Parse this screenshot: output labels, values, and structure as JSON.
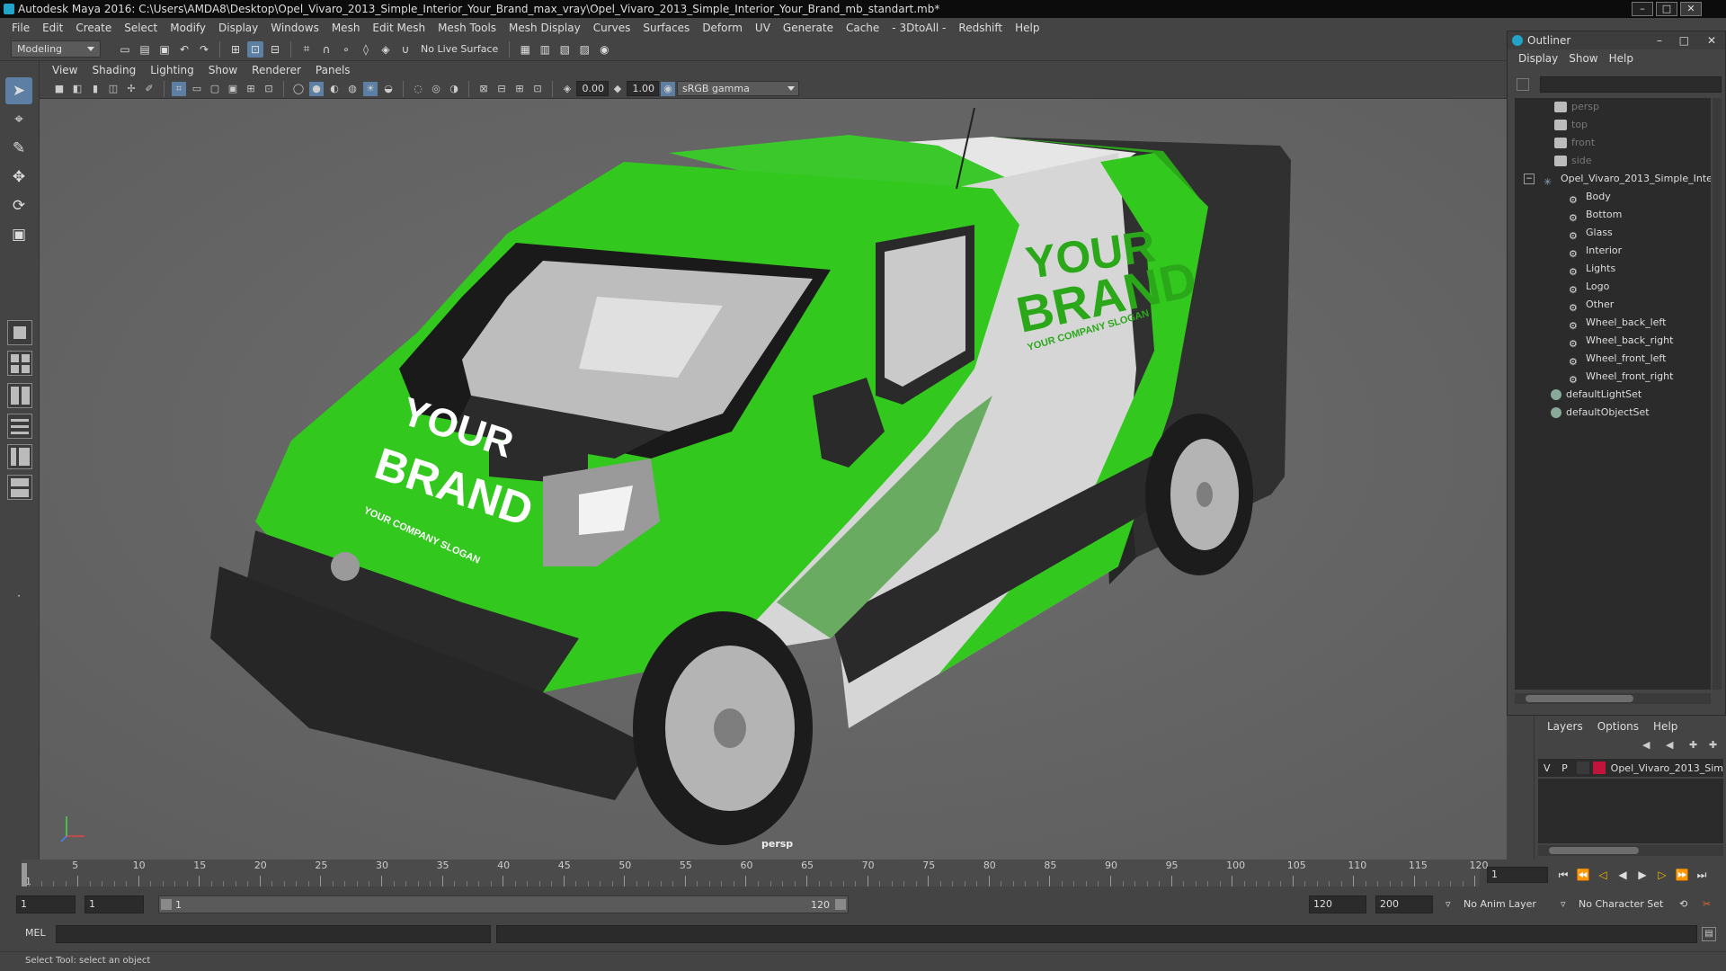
{
  "window": {
    "title": "Autodesk Maya 2016: C:\\Users\\AMDA8\\Desktop\\Opel_Vivaro_2013_Simple_Interior_Your_Brand_max_vray\\Opel_Vivaro_2013_Simple_Interior_Your_Brand_mb_standart.mb*",
    "minimize": "–",
    "maximize": "□",
    "close": "✕"
  },
  "menu": [
    "File",
    "Edit",
    "Create",
    "Select",
    "Modify",
    "Display",
    "Windows",
    "Mesh",
    "Edit Mesh",
    "Mesh Tools",
    "Mesh Display",
    "Curves",
    "Surfaces",
    "Deform",
    "UV",
    "Generate",
    "Cache",
    "- 3DtoAll -",
    "Redshift",
    "Help"
  ],
  "shelf": {
    "mode": "Modeling",
    "live_surface": "No Live Surface"
  },
  "panel_menu": [
    "View",
    "Shading",
    "Lighting",
    "Show",
    "Renderer",
    "Panels"
  ],
  "panel_toolbar": {
    "exposure": "0.00",
    "gamma": "1.00",
    "color_space": "sRGB gamma"
  },
  "viewport": {
    "camera_label": "persp",
    "brand_line1": "YOUR",
    "brand_line2": "BRAND",
    "slogan": "YOUR COMPANY SLOGAN",
    "colors": {
      "green": "#32c81e",
      "dark_green": "#1f8f12",
      "white": "#d8d8d8",
      "dark": "#2a2a2a",
      "grid_bg": "#686868"
    }
  },
  "outliner": {
    "title": "Outliner",
    "menu": [
      "Display",
      "Show",
      "Help"
    ],
    "cameras": [
      "persp",
      "top",
      "front",
      "side"
    ],
    "root": "Opel_Vivaro_2013_Simple_Inte",
    "children": [
      "Body",
      "Bottom",
      "Glass",
      "Interior",
      "Lights",
      "Logo",
      "Other",
      "Wheel_back_left",
      "Wheel_back_right",
      "Wheel_front_left",
      "Wheel_front_right"
    ],
    "sets": [
      "defaultLightSet",
      "defaultObjectSet"
    ]
  },
  "layers": {
    "menu": [
      "Layers",
      "Options",
      "Help"
    ],
    "row": {
      "v": "V",
      "p": "P",
      "name": "Opel_Vivaro_2013_Sim",
      "color": "#c0143c"
    }
  },
  "timeline": {
    "ticks": [
      "5",
      "10",
      "15",
      "20",
      "25",
      "30",
      "35",
      "40",
      "45",
      "50",
      "55",
      "60",
      "65",
      "70",
      "75",
      "80",
      "85",
      "90",
      "95",
      "100",
      "105",
      "110",
      "115",
      "120"
    ],
    "start_label": "1",
    "current_frame": "1"
  },
  "range": {
    "start": "1",
    "playback_start": "1",
    "slider_start": "1",
    "slider_end": "120",
    "playback_end": "120",
    "end": "200",
    "anim_layer": "No Anim Layer",
    "char_set": "No Character Set"
  },
  "mel": {
    "label": "MEL"
  },
  "help": {
    "text": "Select Tool: select an object"
  }
}
